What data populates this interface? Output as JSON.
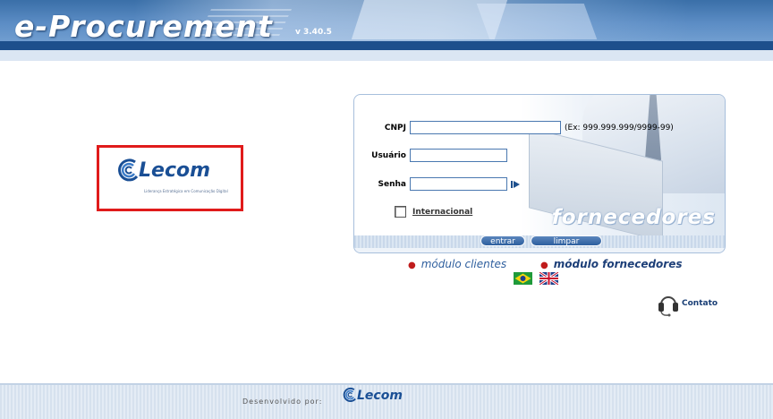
{
  "header": {
    "title": "e-Procurement",
    "version": "v 3.40.5"
  },
  "brand": {
    "logo_text": "Lecom",
    "logo_tagline": "Liderança Estratégica em Comunicação Digital",
    "highlight_color": "#e01b1b",
    "logo_color": "#1a4f95"
  },
  "login": {
    "cnpj_label": "CNPJ",
    "cnpj_value": "",
    "cnpj_hint": "(Ex: 999.999.999/9999-99)",
    "user_label": "Usuário",
    "user_value": "",
    "password_label": "Senha",
    "password_value": "",
    "international_label": "Internacional",
    "panel_word": "fornecedores",
    "enter_label": "entrar",
    "clear_label": "limpar"
  },
  "modules": {
    "clients_label": "módulo clientes",
    "suppliers_label": "módulo fornecedores"
  },
  "languages": [
    {
      "name": "brazil-flag-icon"
    },
    {
      "name": "uk-flag-icon"
    }
  ],
  "contact": {
    "label": "Contato",
    "icon": "headset-icon"
  },
  "footer": {
    "developed_by": "Desenvolvido por:",
    "logo_text": "Lecom"
  }
}
